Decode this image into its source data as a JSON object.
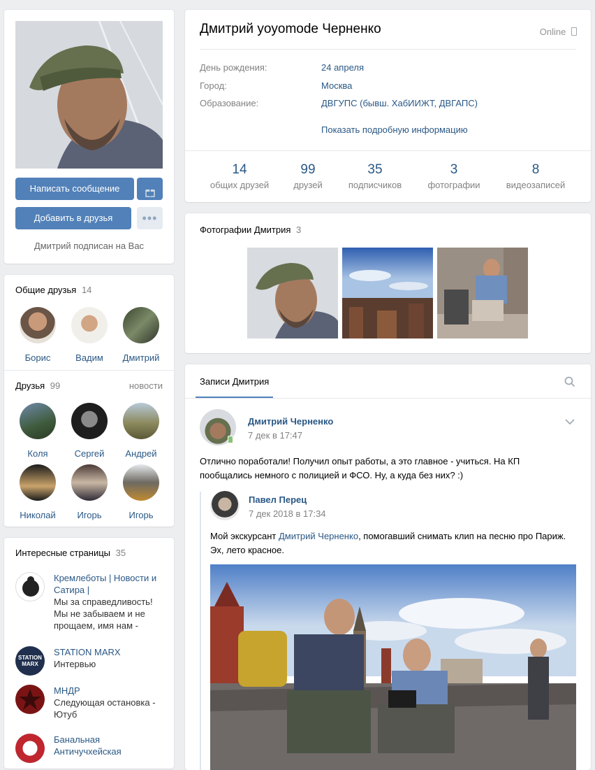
{
  "profile": {
    "name": "Дмитрий yoyomode Черненко",
    "status": "Online",
    "info": [
      {
        "label": "День рождения:",
        "value": "24 апреля"
      },
      {
        "label": "Город:",
        "value": "Москва"
      },
      {
        "label": "Образование:",
        "value": "ДВГУПС (бывш. ХабИИЖТ, ДВГАПС)"
      }
    ],
    "show_more": "Показать подробную информацию",
    "counters": [
      {
        "num": "14",
        "label": "общих друзей"
      },
      {
        "num": "99",
        "label": "друзей"
      },
      {
        "num": "35",
        "label": "подписчиков"
      },
      {
        "num": "3",
        "label": "фотографии"
      },
      {
        "num": "8",
        "label": "видеозаписей"
      }
    ]
  },
  "actions": {
    "message": "Написать сообщение",
    "add_friend": "Добавить в друзья",
    "subscribed_note": "Дмитрий подписан на Вас"
  },
  "mutual_friends": {
    "title": "Общие друзья",
    "count": "14",
    "items": [
      {
        "name": "Борис"
      },
      {
        "name": "Вадим"
      },
      {
        "name": "Дмитрий"
      }
    ]
  },
  "friends": {
    "title": "Друзья",
    "count": "99",
    "news_link": "новости",
    "items": [
      {
        "name": "Коля"
      },
      {
        "name": "Сергей"
      },
      {
        "name": "Андрей"
      },
      {
        "name": "Николай"
      },
      {
        "name": "Игорь"
      },
      {
        "name": "Игорь"
      }
    ]
  },
  "pages": {
    "title": "Интересные страницы",
    "count": "35",
    "items": [
      {
        "title": "Кремлеботы | Новости и Сатира |",
        "desc": "Мы за справедливость! Мы не забываем и не прощаем, имя нам -"
      },
      {
        "title": "STATION MARX",
        "desc": "Интервью",
        "logo_text": "STATION MARX"
      },
      {
        "title": "МНДР",
        "desc": "Следующая остановка - Ютуб"
      },
      {
        "title": "Банальная Античучхейская",
        "desc": ""
      }
    ]
  },
  "photos": {
    "title": "Фотографии Дмитрия",
    "count": "3"
  },
  "wall": {
    "tab": "Записи Дмитрия",
    "post": {
      "author": "Дмитрий Черненко",
      "date": "7 дек в 17:47",
      "text": "Отлично поработали! Получил опыт работы, а это главное - учиться. На КП пообщались немного с полицией и ФСО. Ну, а куда без них? :)",
      "repost": {
        "author": "Павел Перец",
        "date": "7 дек 2018 в 17:34",
        "text_before": "Мой экскурсант ",
        "mention": "Дмитрий Черненко",
        "text_after": ", помогавший снимать клип на песню про Париж. Эх, лето красное."
      }
    }
  },
  "colors": {
    "background": "#edeef0",
    "accent": "#5181b8",
    "link": "#2a5885",
    "muted": "#828282"
  }
}
